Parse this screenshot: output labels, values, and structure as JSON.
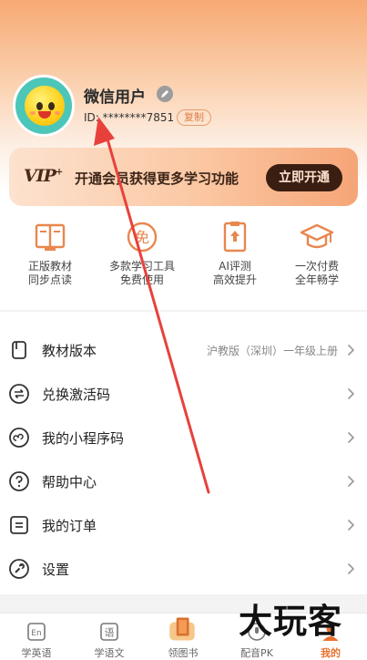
{
  "profile": {
    "username": "微信用户",
    "user_id": "ID: ********7851",
    "copy_label": "复制"
  },
  "vip": {
    "logo": "VIP",
    "text": "开通会员获得更多学习功能",
    "button": "立即开通"
  },
  "features": [
    {
      "line1": "正版教材",
      "line2": "同步点读",
      "icon": "book-icon"
    },
    {
      "line1": "多款学习工具",
      "line2": "免费使用",
      "icon": "free-icon"
    },
    {
      "line1": "AI评测",
      "line2": "高效提升",
      "icon": "clipboard-icon"
    },
    {
      "line1": "一次付费",
      "line2": "全年畅学",
      "icon": "graduation-cap-icon"
    }
  ],
  "menu": [
    {
      "label": "教材版本",
      "value": "沪教版（深圳）一年级上册",
      "icon": "textbook-icon"
    },
    {
      "label": "兑换激活码",
      "value": "",
      "icon": "exchange-icon"
    },
    {
      "label": "我的小程序码",
      "value": "",
      "icon": "miniprogram-icon"
    },
    {
      "label": "帮助中心",
      "value": "",
      "icon": "help-icon"
    },
    {
      "label": "我的订单",
      "value": "",
      "icon": "order-icon"
    },
    {
      "label": "设置",
      "value": "",
      "icon": "wrench-icon"
    }
  ],
  "tabs": [
    {
      "label": "学英语",
      "icon": "en-icon"
    },
    {
      "label": "学语文",
      "icon": "chinese-icon"
    },
    {
      "label": "领图书",
      "icon": "gift-book-icon"
    },
    {
      "label": "配音PK",
      "icon": "dub-icon"
    },
    {
      "label": "我的",
      "icon": "me-icon",
      "active": true
    }
  ],
  "watermark": "大玩客",
  "colors": {
    "accent": "#e8712f",
    "vip_button": "#3a1e12",
    "annotation_arrow": "#e8413c"
  }
}
